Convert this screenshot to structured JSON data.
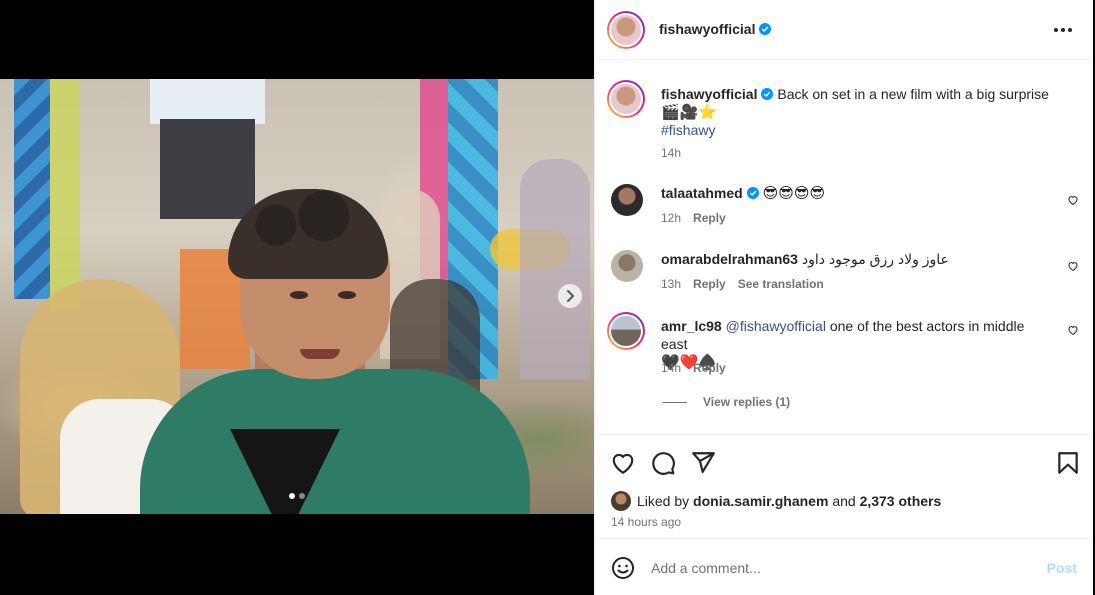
{
  "post": {
    "username": "fishawyofficial",
    "caption": "Back on set in a new film with a big surprise",
    "caption_emojis": "🎬🎥⭐",
    "hashtag": "#fishawy",
    "caption_time": "14h"
  },
  "header": {
    "username": "fishawyofficial"
  },
  "comments": [
    {
      "username": "talaatahmed",
      "verified": true,
      "text": "😎😎😎😎",
      "time": "12h",
      "reply_label": "Reply"
    },
    {
      "username": "omarabdelrahman63",
      "verified": false,
      "text": "عاوز ولاد رزق موجود داود",
      "time": "13h",
      "reply_label": "Reply",
      "translation_label": "See translation"
    },
    {
      "username": "amr_lc98",
      "verified": false,
      "mention": "@fishawyofficial",
      "text": "one of the best actors in middle east",
      "emojis": "🖤❤️♠️",
      "time": "14h",
      "reply_label": "Reply",
      "view_replies": "View replies (1)"
    }
  ],
  "likes": {
    "prefix": "Liked by",
    "user": "donia.samir.ghanem",
    "and": "and",
    "others": "2,373 others"
  },
  "posted_ago": "14 hours ago",
  "composer": {
    "placeholder": "Add a comment...",
    "post_label": "Post"
  },
  "carousel": {
    "active_index": 0,
    "count": 2
  },
  "colors": {
    "accent": "#0095f6",
    "link": "#385185",
    "muted": "#737373"
  }
}
